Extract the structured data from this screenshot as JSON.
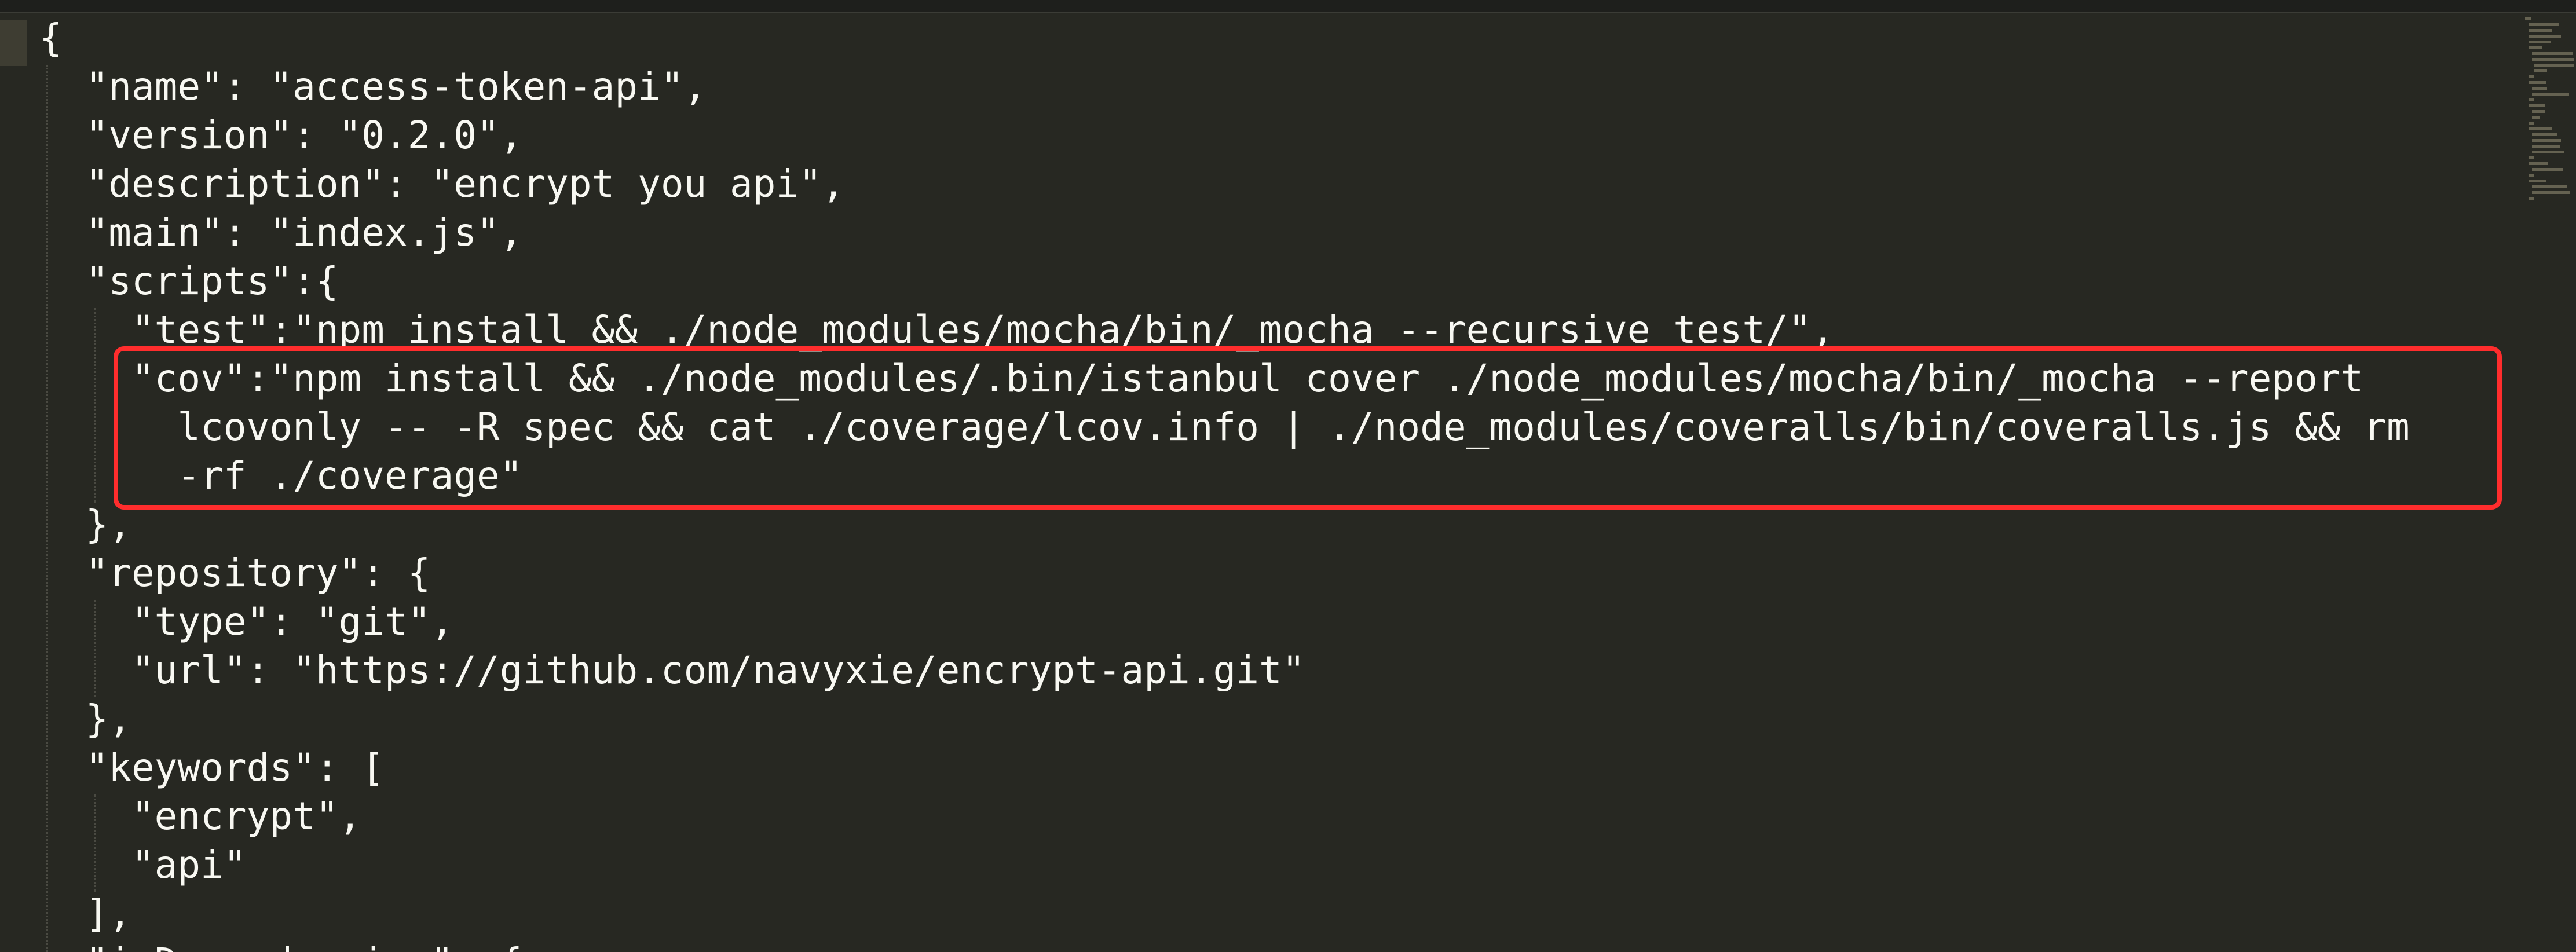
{
  "editor": {
    "lines": [
      "{",
      "  \"name\": \"access-token-api\",",
      "  \"version\": \"0.2.0\",",
      "  \"description\": \"encrypt you api\",",
      "  \"main\": \"index.js\",",
      "  \"scripts\":{",
      "    \"test\":\"npm install && ./node_modules/mocha/bin/_mocha --recursive test/\",",
      "    \"cov\":\"npm install && ./node_modules/.bin/istanbul cover ./node_modules/mocha/bin/_mocha --report",
      "      lcovonly -- -R spec && cat ./coverage/lcov.info | ./node_modules/coveralls/bin/coveralls.js && rm",
      "      -rf ./coverage\"",
      "  },",
      "  \"repository\": {",
      "    \"type\": \"git\",",
      "    \"url\": \"https://github.com/navyxie/encrypt-api.git\"",
      "  },",
      "  \"keywords\": [",
      "    \"encrypt\",",
      "    \"api\"",
      "  ],",
      "  \"isDependencies\": {"
    ],
    "highlighted_lines": [
      8,
      9,
      10
    ]
  },
  "colors": {
    "background": "#272822",
    "text": "#f8f8f2",
    "highlight_border": "#ff2d2d",
    "gutter_marker": "#3e3d32"
  }
}
